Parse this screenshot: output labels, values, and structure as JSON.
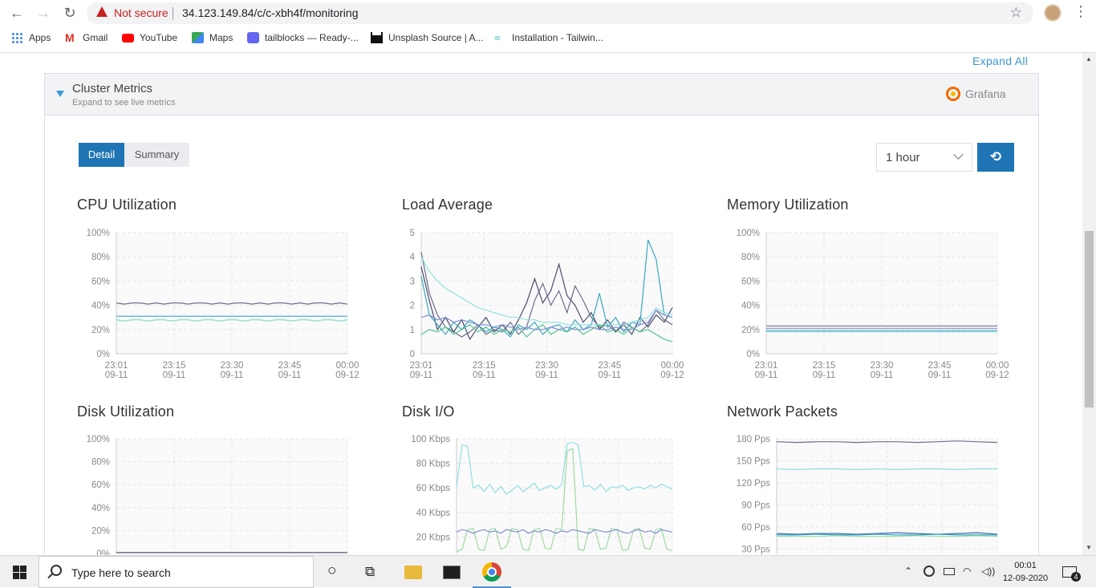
{
  "browser": {
    "security_label": "Not secure",
    "url": "34.123.149.84/c/c-xbh4f/monitoring",
    "bookmarks": [
      {
        "label": "Apps",
        "icon": "apps-grid-icon"
      },
      {
        "label": "Gmail",
        "icon": "gmail-icon"
      },
      {
        "label": "YouTube",
        "icon": "youtube-icon"
      },
      {
        "label": "Maps",
        "icon": "maps-icon"
      },
      {
        "label": "tailblocks — Ready-...",
        "icon": "tailblocks-icon"
      },
      {
        "label": "Unsplash Source | A...",
        "icon": "unsplash-icon"
      },
      {
        "label": "Installation - Tailwin...",
        "icon": "tailwind-icon"
      }
    ]
  },
  "page": {
    "expand_all": "Expand All",
    "panel": {
      "title": "Cluster Metrics",
      "subtitle": "Expand to see live metrics",
      "grafana_label": "Grafana"
    },
    "tabs": {
      "detail": "Detail",
      "summary": "Summary"
    },
    "range_select": "1 hour",
    "refresh_icon": "refresh-icon",
    "colors": {
      "accent": "#1f75b4",
      "link": "#3d98d3"
    }
  },
  "chart_data": [
    {
      "type": "line",
      "title": "CPU Utilization",
      "ylim": [
        0,
        100
      ],
      "yticks": [
        "0%",
        "20%",
        "40%",
        "60%",
        "80%",
        "100%"
      ],
      "xticks": [
        [
          "23:01",
          "09-11"
        ],
        [
          "23:15",
          "09-11"
        ],
        [
          "23:30",
          "09-11"
        ],
        [
          "23:45",
          "09-11"
        ],
        [
          "00:00",
          "09-12"
        ]
      ],
      "grid": true,
      "series": [
        {
          "color": "#6b6f8e",
          "values": [
            42,
            41,
            42,
            42,
            41,
            42,
            41,
            42,
            42,
            41,
            42,
            42,
            41,
            42,
            41,
            42,
            42,
            41,
            42,
            41,
            42,
            42,
            41,
            42,
            41,
            42,
            42,
            41,
            42,
            41
          ]
        },
        {
          "color": "#3aa8c1",
          "values": [
            31,
            31,
            31,
            31,
            31,
            31,
            31,
            31,
            31,
            31,
            31,
            31,
            31,
            31,
            31,
            31,
            31,
            31,
            31,
            31,
            31,
            31,
            31,
            31,
            31,
            31,
            31,
            31,
            31,
            31
          ]
        },
        {
          "color": "#7ad8c6",
          "values": [
            28,
            27,
            28,
            28,
            27,
            28,
            28,
            27,
            28,
            28,
            27,
            28,
            28,
            27,
            28,
            28,
            27,
            28,
            28,
            27,
            28,
            28,
            27,
            28,
            28,
            27,
            28,
            28,
            27,
            28
          ]
        }
      ]
    },
    {
      "type": "line",
      "title": "Load Average",
      "ylim": [
        0,
        5
      ],
      "yticks": [
        "0",
        "1",
        "2",
        "3",
        "4",
        "5"
      ],
      "xticks": [
        [
          "23:01",
          "09-11"
        ],
        [
          "23:15",
          "09-11"
        ],
        [
          "23:30",
          "09-11"
        ],
        [
          "23:45",
          "09-11"
        ],
        [
          "00:00",
          "09-12"
        ]
      ],
      "grid": true,
      "series": [
        {
          "color": "#6b6f8e",
          "values": [
            4.2,
            2.5,
            1.6,
            1.1,
            0.9,
            0.7,
            0.9,
            1.2,
            0.8,
            1.0,
            0.9,
            1.3,
            0.8,
            1.1,
            2.2,
            2.9,
            2.0,
            2.6,
            1.7,
            2.8,
            2.2,
            1.5,
            1.1,
            1.2,
            0.9,
            1.3,
            1.1,
            0.9,
            1.2,
            1.8,
            1.4,
            1.2
          ]
        },
        {
          "color": "#4a4e6a",
          "values": [
            3.6,
            2.2,
            1.0,
            1.5,
            0.9,
            1.4,
            0.6,
            1.1,
            1.5,
            0.9,
            1.2,
            0.8,
            1.4,
            2.1,
            3.1,
            2.1,
            2.6,
            3.7,
            2.4,
            2.0,
            1.3,
            1.7,
            1.0,
            1.4,
            0.9,
            1.2,
            0.8,
            1.5,
            1.1,
            1.6,
            1.3,
            1.9
          ]
        },
        {
          "color": "#3aa8c1",
          "values": [
            3.2,
            1.6,
            1.2,
            0.8,
            1.3,
            1.0,
            1.4,
            1.2,
            0.9,
            1.1,
            1.0,
            0.7,
            1.2,
            1.0,
            1.3,
            0.8,
            1.1,
            1.2,
            0.9,
            1.4,
            1.0,
            1.2,
            2.5,
            1.1,
            1.5,
            0.9,
            1.3,
            1.2,
            4.7,
            3.9,
            1.6,
            1.5
          ]
        },
        {
          "color": "#8fe0e0",
          "values": [
            4.0,
            3.4,
            3.0,
            2.7,
            2.5,
            2.3,
            2.1,
            1.9,
            1.8,
            1.7,
            1.6,
            1.5,
            1.5,
            1.4,
            1.4,
            1.3,
            1.3,
            1.3,
            1.2,
            1.2,
            1.2,
            1.2,
            1.2,
            1.2,
            1.2,
            1.2,
            1.3,
            1.4,
            1.5,
            1.9,
            1.7,
            1.6
          ]
        },
        {
          "color": "#56c596",
          "values": [
            0.8,
            1.0,
            0.9,
            1.1,
            0.8,
            1.0,
            1.2,
            0.9,
            1.1,
            0.8,
            1.0,
            0.9,
            1.1,
            0.7,
            1.0,
            1.2,
            0.8,
            1.0,
            0.9,
            1.1,
            0.8,
            1.0,
            1.2,
            0.9,
            1.0,
            0.8,
            1.1,
            0.9,
            1.0,
            0.8,
            0.6,
            0.5
          ]
        },
        {
          "color": "#7e8fd6",
          "values": [
            1.5,
            1.6,
            1.4,
            1.5,
            1.3,
            1.4,
            1.3,
            1.2,
            1.2,
            1.1,
            1.2,
            1.1,
            1.0,
            1.1,
            1.0,
            1.0,
            1.1,
            1.0,
            1.1,
            1.0,
            1.0,
            1.1,
            1.0,
            1.0,
            1.1,
            1.0,
            1.0,
            1.2,
            1.3,
            1.8,
            1.6,
            1.5
          ]
        }
      ]
    },
    {
      "type": "line",
      "title": "Memory Utilization",
      "ylim": [
        0,
        100
      ],
      "yticks": [
        "0%",
        "20%",
        "40%",
        "60%",
        "80%",
        "100%"
      ],
      "xticks": [
        [
          "23:01",
          "09-11"
        ],
        [
          "23:15",
          "09-11"
        ],
        [
          "23:30",
          "09-11"
        ],
        [
          "23:45",
          "09-11"
        ],
        [
          "00:00",
          "09-12"
        ]
      ],
      "grid": true,
      "series": [
        {
          "color": "#6b6f8e",
          "values": [
            23,
            23,
            23,
            23,
            23,
            23,
            23,
            23,
            23,
            23
          ]
        },
        {
          "color": "#7e8fd6",
          "values": [
            21,
            21,
            21,
            21,
            21,
            21,
            21,
            21,
            21,
            21
          ]
        },
        {
          "color": "#3aa8c1",
          "values": [
            19,
            19,
            19,
            19,
            19,
            19,
            19,
            19,
            19,
            19
          ]
        },
        {
          "color": "#8fe0e0",
          "values": [
            18,
            18,
            18,
            18,
            18,
            18,
            18,
            18,
            18,
            18
          ]
        }
      ]
    },
    {
      "type": "line",
      "title": "Disk Utilization",
      "ylim": [
        0,
        100
      ],
      "yticks": [
        "0%",
        "20%",
        "40%",
        "60%",
        "80%",
        "100%"
      ],
      "grid": true,
      "series": [
        {
          "color": "#6b6f8e",
          "values": [
            1,
            1,
            1,
            1,
            1,
            1,
            1,
            1,
            1,
            1
          ]
        }
      ]
    },
    {
      "type": "line",
      "title": "Disk I/O",
      "ylim": [
        0,
        100
      ],
      "yticks": [
        "20 Kbps",
        "40 Kbps",
        "60 Kbps",
        "80 Kbps",
        "100 Kbps"
      ],
      "grid": true,
      "series": [
        {
          "color": "#8fe0e0",
          "values": [
            61,
            95,
            94,
            60,
            62,
            57,
            63,
            56,
            61,
            55,
            58,
            62,
            57,
            60,
            64,
            58,
            60,
            62,
            59,
            63,
            96,
            97,
            95,
            61,
            62,
            58,
            63,
            57,
            61,
            60,
            62,
            58,
            60,
            61,
            59,
            62,
            60,
            63,
            61,
            59
          ]
        },
        {
          "color": "#9fd9a0",
          "values": [
            8,
            10,
            26,
            27,
            10,
            9,
            26,
            27,
            10,
            12,
            27,
            26,
            10,
            9,
            26,
            27,
            11,
            10,
            27,
            26,
            90,
            92,
            10,
            9,
            27,
            26,
            10,
            11,
            27,
            26,
            9,
            10,
            26,
            27,
            11,
            10,
            26,
            27,
            10,
            9
          ]
        },
        {
          "color": "#7e8fd6",
          "values": [
            24,
            26,
            25,
            23,
            25,
            26,
            24,
            25,
            23,
            26,
            25,
            24,
            26,
            23,
            25,
            24,
            26,
            25,
            23,
            25,
            24,
            26,
            25,
            24,
            23,
            26,
            25,
            24,
            25,
            26,
            24,
            23,
            25,
            26,
            24,
            25,
            23,
            26,
            25,
            24
          ]
        },
        {
          "color": "#4a4e6a",
          "values": [
            0,
            0,
            0,
            0,
            0,
            0,
            0,
            0,
            0,
            0,
            0,
            0,
            0,
            0,
            0,
            0,
            0,
            0,
            0,
            0,
            0,
            0,
            0,
            0,
            0,
            0,
            0,
            0,
            0,
            0,
            0,
            0,
            0,
            0,
            0,
            0,
            0,
            0,
            0,
            0
          ]
        }
      ]
    },
    {
      "type": "line",
      "title": "Network Packets",
      "ylim": [
        15,
        180
      ],
      "yticks": [
        "30 Pps",
        "60 Pps",
        "90 Pps",
        "120 Pps",
        "150 Pps",
        "180 Pps"
      ],
      "grid": true,
      "series": [
        {
          "color": "#6b6f8e",
          "values": [
            176,
            175,
            176,
            176,
            175,
            176,
            176,
            175,
            176,
            177,
            176,
            175
          ]
        },
        {
          "color": "#8fe0e0",
          "values": [
            139,
            138,
            139,
            139,
            138,
            139,
            138,
            139,
            139,
            138,
            139,
            139
          ]
        },
        {
          "color": "#3a6fb0",
          "values": [
            51,
            50,
            51,
            51,
            50,
            51,
            52,
            51,
            50,
            51,
            52,
            50
          ]
        },
        {
          "color": "#3aa8c1",
          "values": [
            49,
            49,
            50,
            49,
            49,
            50,
            49,
            49,
            50,
            49,
            49,
            49
          ]
        },
        {
          "color": "#9fd9a0",
          "values": [
            47,
            47,
            47,
            48,
            47,
            47,
            47,
            48,
            47,
            47,
            48,
            47
          ]
        }
      ]
    }
  ],
  "taskbar": {
    "search_placeholder": "Type here to search",
    "time": "00:01",
    "date": "12-09-2020",
    "notification_count": "4"
  }
}
